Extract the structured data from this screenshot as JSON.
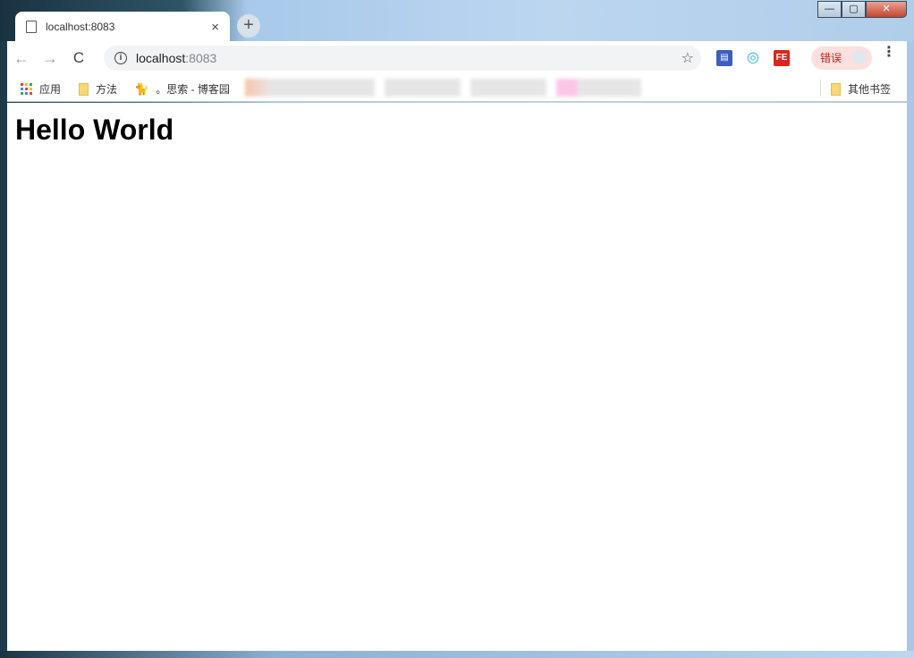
{
  "window": {
    "minimize": "—",
    "maximize": "▢",
    "close": "✕"
  },
  "tab": {
    "title": "localhost:8083",
    "close": "×",
    "new_tab": "+"
  },
  "toolbar": {
    "back": "←",
    "forward": "→",
    "reload": "C",
    "info": "i",
    "url_host": "localhost",
    "url_port": ":8083",
    "star": "☆",
    "error_badge": "错误",
    "menu": "⋮"
  },
  "extensions": [
    {
      "name": "save",
      "label": "▤",
      "color": "#3b5fc0"
    },
    {
      "name": "globe",
      "label": "◎",
      "color": "#2bb5c9"
    },
    {
      "name": "fe",
      "label": "FE",
      "color": "#d9261c"
    }
  ],
  "bookmarks": {
    "apps": "应用",
    "items": [
      "方法",
      "。思索 - 博客园"
    ],
    "other": "其他书签"
  },
  "page": {
    "heading": "Hello World"
  }
}
